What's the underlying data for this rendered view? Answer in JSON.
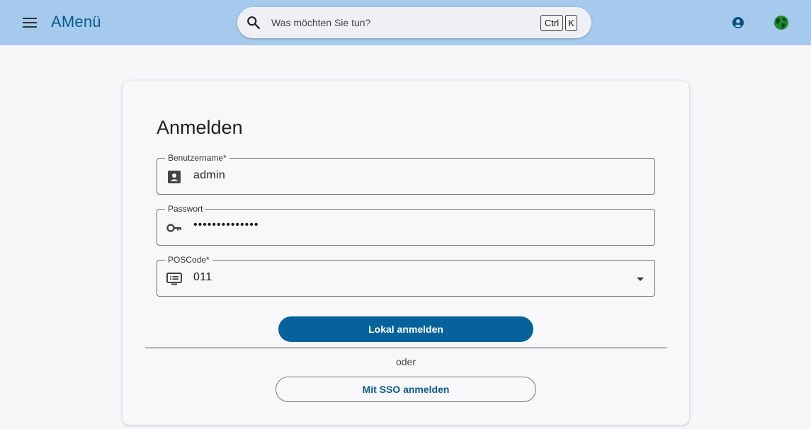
{
  "header": {
    "app_title": "AMenü",
    "menu_icon": "menu-icon",
    "search": {
      "placeholder": "Was möchten Sie tun?",
      "shortcut_ctrl": "Ctrl",
      "shortcut_key": "K"
    },
    "account_icon": "account-circle-icon",
    "language_icon": "globe-icon"
  },
  "login": {
    "title": "Anmelden",
    "username": {
      "label": "Benutzername*",
      "value": "admin",
      "icon": "contact-card-icon"
    },
    "password": {
      "label": "Passwort",
      "value": "••••••••••••••",
      "icon": "key-icon"
    },
    "poscode": {
      "label": "POSCode*",
      "value": "011",
      "icon": "terminal-icon"
    },
    "local_button": "Lokal anmelden",
    "separator": "oder",
    "sso_button": "Mit SSO anmelden"
  },
  "colors": {
    "header_bg": "#a6caee",
    "primary": "#05629a",
    "title_blue": "#0b5a8c",
    "globe_green": "#1e8a2e"
  }
}
